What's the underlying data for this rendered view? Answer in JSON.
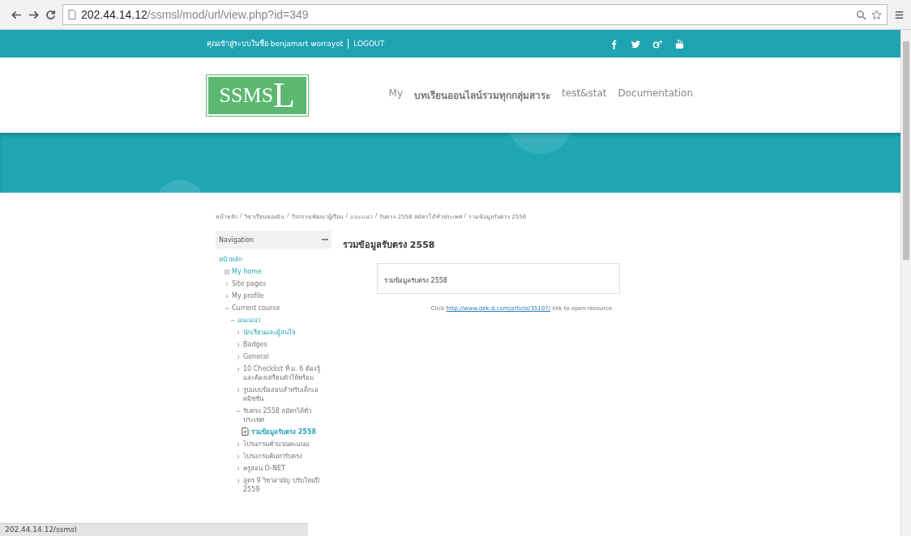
{
  "browser": {
    "url_host": "202.44.14.12",
    "url_path": "/ssmsl/mod/url/view.php?id=349"
  },
  "topbar": {
    "login_text": "คุณเข้าสู่ระบบในชื่อ benjamart worrayot",
    "logout": "LOGOUT"
  },
  "logo": {
    "text": "SSMS",
    "letter": "L"
  },
  "menu": [
    {
      "label": "My",
      "bold": false
    },
    {
      "label": "บทเรียนออนไลน์รวมทุกกลุ่มสาระ",
      "bold": true
    },
    {
      "label": "test&stat",
      "bold": false
    },
    {
      "label": "Documentation",
      "bold": false
    }
  ],
  "breadcrumb_separator": "/",
  "breadcrumb": [
    "หน้าหลัก",
    "วิชาเรียนของฉัน",
    "กิจกรรมพัฒนาผู้เรียน",
    "แนะแนว",
    "รับตรง 2558 สมัครได้ทั่วประเทศ",
    "รวมข้อมูลรับตรง 2558"
  ],
  "navigation": {
    "title": "Navigation",
    "items": [
      {
        "label": "หน้าหลัก",
        "kind": "root",
        "linked": true,
        "selected": false,
        "children": [
          {
            "label": "My home",
            "kind": "bullet",
            "linked": true,
            "selected": false
          },
          {
            "label": "Site pages",
            "kind": "branch",
            "expanded": false,
            "linked": false,
            "selected": false
          },
          {
            "label": "My profile",
            "kind": "branch",
            "expanded": false,
            "linked": false,
            "selected": false
          },
          {
            "label": "Current course",
            "kind": "branch",
            "expanded": true,
            "linked": false,
            "selected": false,
            "children": [
              {
                "label": "แนะแนว",
                "kind": "branch",
                "expanded": true,
                "linked": true,
                "selected": false,
                "children": [
                  {
                    "label": "นักเรียนและผู้สนใจ",
                    "kind": "branch",
                    "expanded": false,
                    "linked": true,
                    "selected": false
                  },
                  {
                    "label": "Badges",
                    "kind": "branch",
                    "expanded": false,
                    "linked": false,
                    "selected": false
                  },
                  {
                    "label": "General",
                    "kind": "branch",
                    "expanded": false,
                    "linked": false,
                    "selected": false
                  },
                  {
                    "label": "10 Checklist ที่ ม. 6 ต้องรู้ และต้องเตรียมตัวให้พร้อม",
                    "kind": "branch",
                    "expanded": false,
                    "linked": false,
                    "selected": false
                  },
                  {
                    "label": "รูปแบบข้อสอบสำหรับเด็กเอดมิชชั่น",
                    "kind": "branch",
                    "expanded": false,
                    "linked": false,
                    "selected": false
                  },
                  {
                    "label": "รับตรง 2558 สมัครได้ทั่วประเทศ",
                    "kind": "branch",
                    "expanded": true,
                    "linked": false,
                    "selected": false,
                    "children": [
                      {
                        "label": "รวมข้อมูลรับตรง 2558",
                        "kind": "resource",
                        "linked": true,
                        "selected": true
                      }
                    ]
                  },
                  {
                    "label": "โปรแกรมคำนวณคะแนน",
                    "kind": "branch",
                    "expanded": false,
                    "linked": false,
                    "selected": false
                  },
                  {
                    "label": "โปรแกรมค้นหารับตรง",
                    "kind": "branch",
                    "expanded": false,
                    "linked": false,
                    "selected": false
                  },
                  {
                    "label": "ครูสอน O-NET",
                    "kind": "branch",
                    "expanded": false,
                    "linked": false,
                    "selected": false
                  },
                  {
                    "label": "สูตร 9 วิชาสามัญ ปรับใหม่ปี 2559",
                    "kind": "branch",
                    "expanded": false,
                    "linked": false,
                    "selected": false
                  }
                ]
              }
            ]
          }
        ]
      }
    ]
  },
  "main": {
    "heading": "รวมข้อมูลรับตรง 2558",
    "intro": "รวมข้อมูลรับตรง 2558",
    "click_before": "Click",
    "link": "http://www.dek-d.com/article/35107/",
    "click_after": "link to open resource."
  },
  "status_bar": "202.44.14.12/ssmsl"
}
